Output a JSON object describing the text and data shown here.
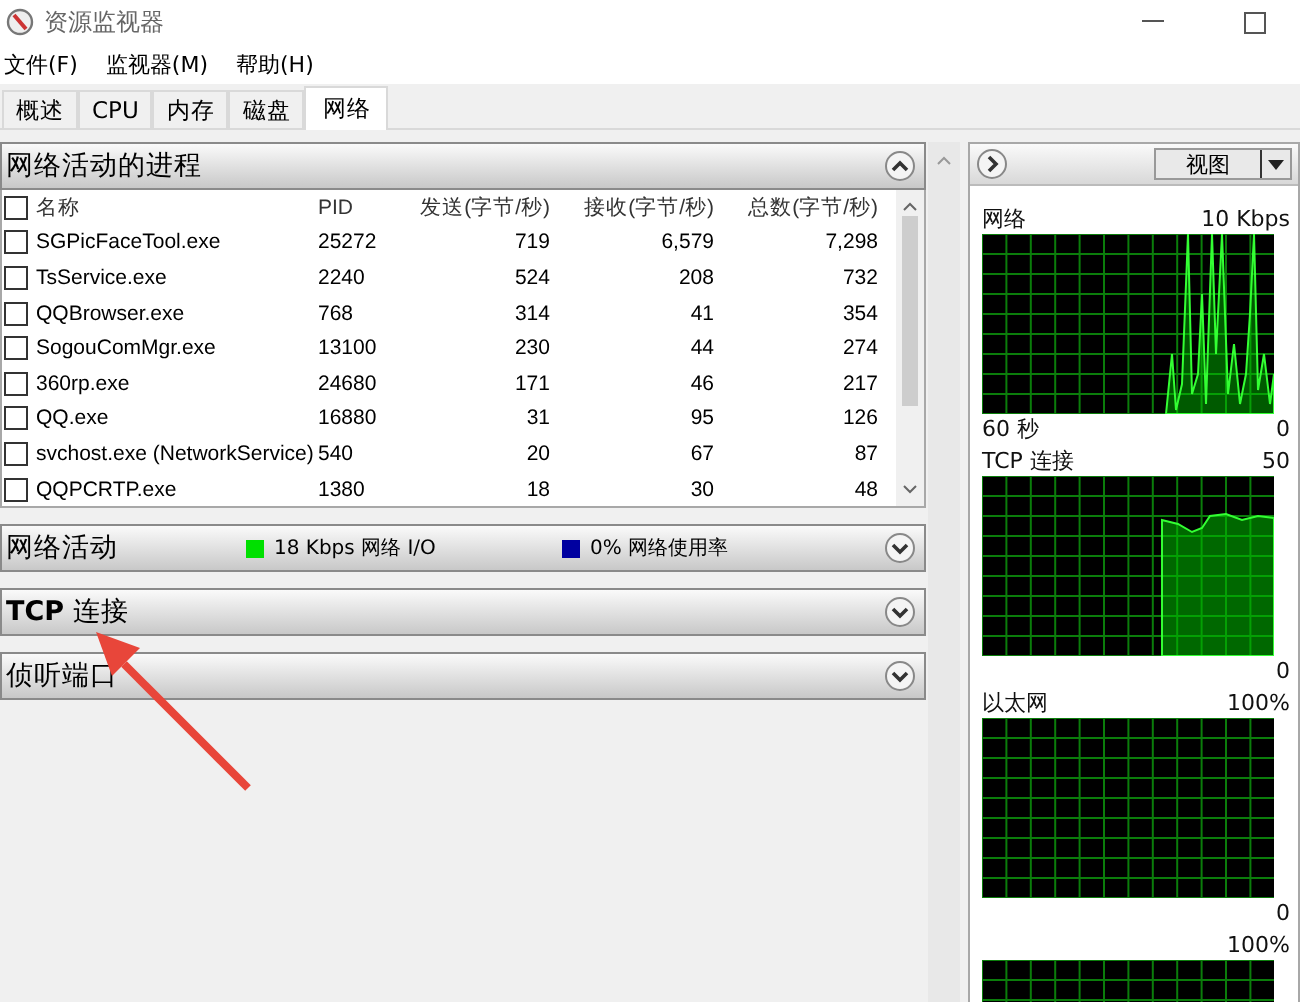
{
  "window": {
    "title": "资源监视器"
  },
  "menu": [
    "文件(F)",
    "监视器(M)",
    "帮助(H)"
  ],
  "tabs": [
    {
      "label": "概述",
      "selected": false
    },
    {
      "label": "CPU",
      "selected": false
    },
    {
      "label": "内存",
      "selected": false
    },
    {
      "label": "磁盘",
      "selected": false
    },
    {
      "label": "网络",
      "selected": true
    }
  ],
  "processes": {
    "title": "网络活动的进程",
    "expanded": true,
    "header_checked": false,
    "columns": [
      "名称",
      "PID",
      "发送(字节/秒)",
      "接收(字节/秒)",
      "总数(字节/秒)"
    ],
    "rows": [
      {
        "checked": false,
        "cells": [
          "SGPicFaceTool.exe",
          "25272",
          "719",
          "6,579",
          "7,298"
        ]
      },
      {
        "checked": false,
        "cells": [
          "TsService.exe",
          "2240",
          "524",
          "208",
          "732"
        ]
      },
      {
        "checked": false,
        "cells": [
          "QQBrowser.exe",
          "768",
          "314",
          "41",
          "354"
        ]
      },
      {
        "checked": false,
        "cells": [
          "SogouComMgr.exe",
          "13100",
          "230",
          "44",
          "274"
        ]
      },
      {
        "checked": false,
        "cells": [
          "360rp.exe",
          "24680",
          "171",
          "46",
          "217"
        ]
      },
      {
        "checked": false,
        "cells": [
          "QQ.exe",
          "16880",
          "31",
          "95",
          "126"
        ]
      },
      {
        "checked": false,
        "cells": [
          "svchost.exe (NetworkService)",
          "540",
          "20",
          "67",
          "87"
        ]
      },
      {
        "checked": false,
        "cells": [
          "QQPCRTP.exe",
          "1380",
          "18",
          "30",
          "48"
        ]
      }
    ]
  },
  "sections": [
    {
      "title": "网络活动",
      "expanded": false,
      "legend": [
        {
          "text": "18 Kbps 网络 I/O",
          "color": "#00e000"
        },
        {
          "text": "0% 网络使用率",
          "color": "#0000a0"
        }
      ]
    },
    {
      "title": "**TCP** 连接",
      "expanded": false
    },
    {
      "title": "侦听端口",
      "expanded": false
    }
  ],
  "side_panel": {
    "view_button": "视图",
    "graphs": [
      {
        "name": "网络",
        "max": "10 Kbps",
        "kind": "spiky",
        "time": "60 秒",
        "min": "0"
      },
      {
        "name": "TCP 连接",
        "max": "50",
        "kind": "step",
        "min": "0"
      },
      {
        "name": "以太网",
        "max": "100%",
        "kind": "empty",
        "min": "0"
      },
      {
        "max": "100%",
        "kind": "empty"
      }
    ]
  }
}
